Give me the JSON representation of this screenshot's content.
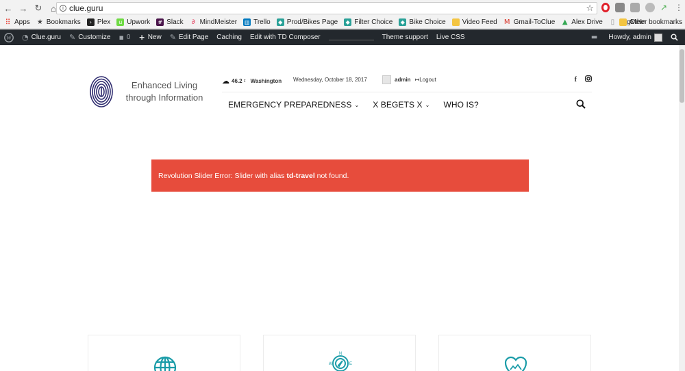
{
  "browser": {
    "url": "clue.guru",
    "bookmarks": [
      {
        "label": "Apps",
        "icon": "apps-grid-icon",
        "color": "#e94235"
      },
      {
        "label": "Bookmarks",
        "icon": "star-icon",
        "color": "#444444"
      },
      {
        "label": "Plex",
        "icon": "plex-icon",
        "color": "#222222"
      },
      {
        "label": "Upwork",
        "icon": "upwork-icon",
        "color": "#6fda44"
      },
      {
        "label": "Slack",
        "icon": "slack-icon",
        "color": "#4a154b"
      },
      {
        "label": "MindMeister",
        "icon": "mindmeister-icon",
        "color": "#e4405f"
      },
      {
        "label": "Trello",
        "icon": "trello-icon",
        "color": "#0079bf"
      },
      {
        "label": "Prod/Bikes Page",
        "icon": "shield-icon",
        "color": "#2aa198"
      },
      {
        "label": "Filter Choice",
        "icon": "shield-icon",
        "color": "#2aa198"
      },
      {
        "label": "Bike Choice",
        "icon": "shield-icon",
        "color": "#2aa198"
      },
      {
        "label": "Video Feed",
        "icon": "folder-icon",
        "color": "#f4c542"
      },
      {
        "label": "Gmail-ToClue",
        "icon": "gmail-icon",
        "color": "#d93025"
      },
      {
        "label": "Alex Drive",
        "icon": "drive-icon",
        "color": "#34a853"
      },
      {
        "label": "LogMeIn",
        "icon": "page-icon",
        "color": "#999999"
      }
    ],
    "other_bookmarks": "Other bookmarks"
  },
  "adminbar": {
    "site": "Clue.guru",
    "customize": "Customize",
    "comments": "0",
    "new": "New",
    "edit_page": "Edit Page",
    "caching": "Caching",
    "td_composer": "Edit with TD Composer",
    "theme_support": "Theme support",
    "live_css": "Live CSS",
    "howdy": "Howdy, admin"
  },
  "header": {
    "logo_line1": "Enhanced Living",
    "logo_line2": "through Information",
    "temp": "46.2",
    "unit": "F",
    "city": "Washington",
    "date": "Wednesday, October 18, 2017",
    "user": "admin",
    "logout": "Logout",
    "social": [
      "f",
      "instagram"
    ]
  },
  "nav": [
    {
      "label": "EMERGENCY PREPAREDNESS",
      "has_dropdown": true
    },
    {
      "label": "X BEGETS X",
      "has_dropdown": true
    },
    {
      "label": "WHO IS?",
      "has_dropdown": false
    }
  ],
  "error": {
    "prefix": "Revolution Slider Error: Slider with alias ",
    "alias": "td-travel",
    "suffix": " not found."
  },
  "colors": {
    "accent": "#1a9ca8",
    "error": "#e74c3c",
    "adminbar": "#23282d"
  }
}
